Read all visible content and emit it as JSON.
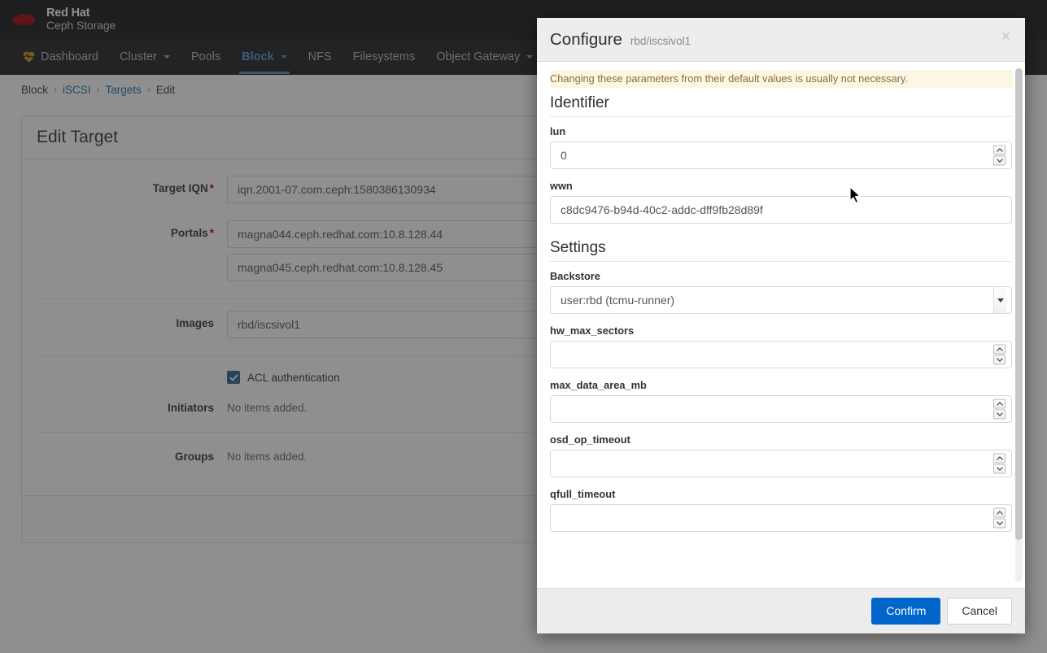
{
  "brand": {
    "logo_icon": "redhat-fedora-icon",
    "line1": "Red Hat",
    "line2": "Ceph Storage"
  },
  "nav": {
    "items": [
      {
        "label": "Dashboard",
        "icon": "heartbeat-icon",
        "caret": false,
        "active": false
      },
      {
        "label": "Cluster",
        "caret": true,
        "active": false
      },
      {
        "label": "Pools",
        "caret": false,
        "active": false
      },
      {
        "label": "Block",
        "caret": true,
        "active": true
      },
      {
        "label": "NFS",
        "caret": false,
        "active": false
      },
      {
        "label": "Filesystems",
        "caret": false,
        "active": false
      },
      {
        "label": "Object Gateway",
        "caret": true,
        "active": false
      }
    ]
  },
  "breadcrumb": {
    "items": [
      {
        "label": "Block",
        "link": false
      },
      {
        "label": "iSCSI",
        "link": true
      },
      {
        "label": "Targets",
        "link": true
      },
      {
        "label": "Edit",
        "link": false
      }
    ],
    "separator": "›"
  },
  "edit_target": {
    "title": "Edit Target",
    "fields": {
      "target_iqn_label": "Target IQN",
      "target_iqn_value": "iqn.2001-07.com.ceph:1580386130934",
      "portals_label": "Portals",
      "portals_values": [
        "magna044.ceph.redhat.com:10.8.128.44",
        "magna045.ceph.redhat.com:10.8.128.45"
      ],
      "images_label": "Images",
      "images_values": [
        "rbd/iscsivol1"
      ],
      "acl_label": "ACL authentication",
      "acl_checked": true,
      "initiators_label": "Initiators",
      "initiators_empty": "No items added.",
      "groups_label": "Groups",
      "groups_empty": "No items added."
    },
    "required_marker": "*"
  },
  "modal": {
    "title": "Configure",
    "subtitle": "rbd/iscsivol1",
    "close_icon": "close-icon",
    "alert": "Changing these parameters from their default values is usually not necessary.",
    "sections": [
      {
        "heading": "Identifier",
        "fields": [
          {
            "label": "lun",
            "value": "0",
            "type": "number"
          },
          {
            "label": "wwn",
            "value": "c8dc9476-b94d-40c2-addc-dff9fb28d89f",
            "type": "text"
          }
        ]
      },
      {
        "heading": "Settings",
        "fields": [
          {
            "label": "Backstore",
            "value": "user:rbd (tcmu-runner)",
            "type": "select"
          },
          {
            "label": "hw_max_sectors",
            "value": "",
            "type": "number"
          },
          {
            "label": "max_data_area_mb",
            "value": "",
            "type": "number"
          },
          {
            "label": "osd_op_timeout",
            "value": "",
            "type": "number"
          },
          {
            "label": "qfull_timeout",
            "value": "",
            "type": "number"
          }
        ]
      }
    ],
    "footer": {
      "confirm_label": "Confirm",
      "cancel_label": "Cancel"
    }
  },
  "colors": {
    "brand_red": "#a30000",
    "primary_blue": "#0066cc",
    "nav_active": "#4a9ad4",
    "alert_bg": "#fcf6e3",
    "alert_text": "#8a6d3b",
    "checkbox_blue": "#2b6092",
    "heart_gold": "#c9921f"
  }
}
